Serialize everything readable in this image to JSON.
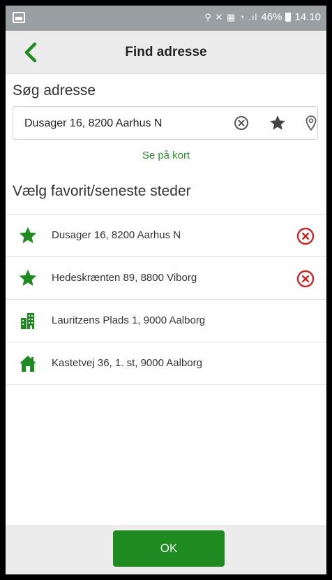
{
  "status_bar": {
    "battery": "46%",
    "time": "14.10",
    "icons_text": "⚲ ✕ ▦ ◔ .ıl"
  },
  "header": {
    "title": "Find adresse"
  },
  "search": {
    "section_label": "Søg adresse",
    "value": "Dusager 16, 8200 Aarhus N",
    "map_link": "Se på kort"
  },
  "favorites": {
    "section_label": "Vælg favorit/seneste steder",
    "items": [
      {
        "label": "Dusager 16, 8200 Aarhus N",
        "icon": "star-icon",
        "removable": true
      },
      {
        "label": "Hedeskræntеn 89, 8800 Viborg",
        "icon": "star-icon",
        "removable": true
      },
      {
        "label": "Lauritzens Plads 1, 9000 Aalborg",
        "icon": "building-icon",
        "removable": false
      },
      {
        "label": "Kastetvej 36, 1. st, 9000 Aalborg",
        "icon": "home-icon",
        "removable": false
      }
    ]
  },
  "footer": {
    "ok_label": "OK"
  },
  "colors": {
    "accent_green": "#1f8a1f",
    "link_green": "#2e8b2e",
    "remove_red": "#c62828",
    "header_bg": "#ececec"
  }
}
